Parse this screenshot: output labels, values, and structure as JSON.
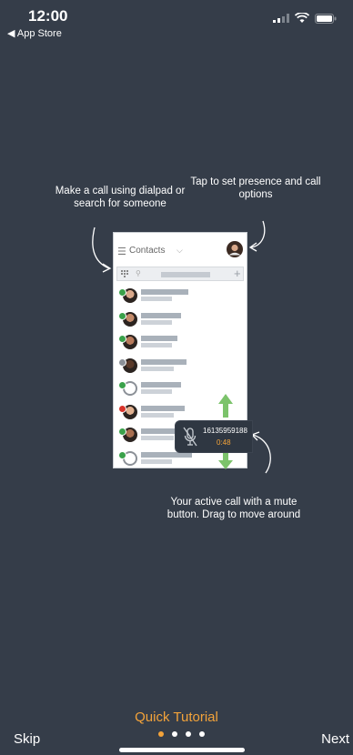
{
  "status_bar": {
    "time": "12:00",
    "back_app": "◀ App Store"
  },
  "callouts": {
    "dialpad": "Make a call using dialpad or search for someone",
    "presence": "Tap to set presence and call options",
    "active_call": "Your active call with a mute button. Drag to move around"
  },
  "phone": {
    "header_title": "Contacts",
    "menu_icon": "hamburger-icon",
    "contacts": [
      {
        "presence": "available",
        "avatar": "photo"
      },
      {
        "presence": "available",
        "avatar": "photo"
      },
      {
        "presence": "available",
        "avatar": "photo"
      },
      {
        "presence": "away",
        "avatar": "photo"
      },
      {
        "presence": "available",
        "avatar": "placeholder"
      },
      {
        "presence": "busy",
        "avatar": "photo"
      },
      {
        "presence": "available",
        "avatar": "photo"
      },
      {
        "presence": "available",
        "avatar": "placeholder"
      }
    ]
  },
  "active_call": {
    "number": "16135959188",
    "duration": "0:48"
  },
  "footer": {
    "title": "Quick Tutorial",
    "skip": "Skip",
    "next": "Next",
    "page_count": 4,
    "current_page": 1
  },
  "colors": {
    "background": "#353d49",
    "accent": "#f3a33a",
    "available": "#3aa14a",
    "busy": "#d9342b",
    "away": "#8b9097",
    "drag_arrow": "#7cc36b"
  }
}
